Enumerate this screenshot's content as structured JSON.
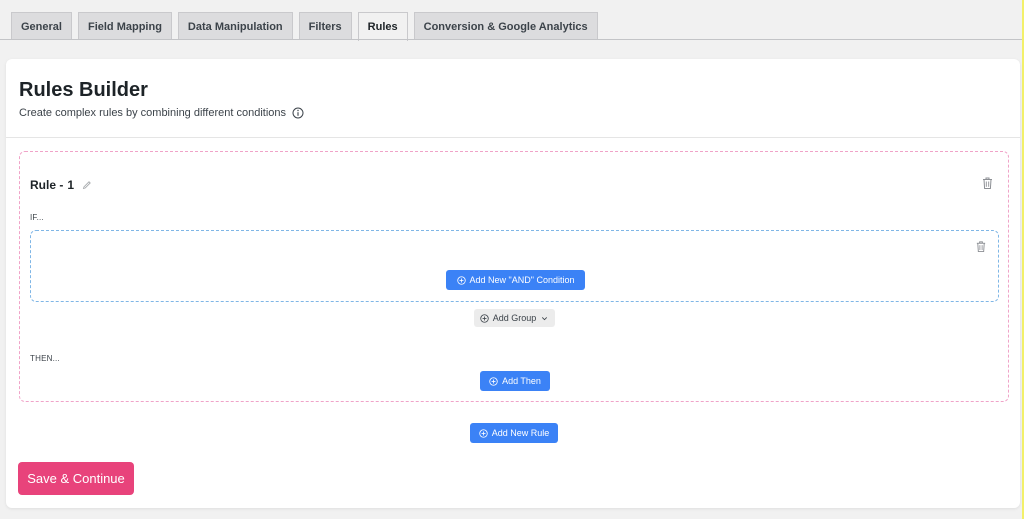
{
  "tabs": [
    {
      "label": "General",
      "active": false
    },
    {
      "label": "Field Mapping",
      "active": false
    },
    {
      "label": "Data Manipulation",
      "active": false
    },
    {
      "label": "Filters",
      "active": false
    },
    {
      "label": "Rules",
      "active": true
    },
    {
      "label": "Conversion & Google Analytics",
      "active": false
    }
  ],
  "builder": {
    "title": "Rules Builder",
    "subtitle": "Create complex rules by combining different conditions"
  },
  "rule": {
    "title_prefix": "Rule -",
    "number": "1",
    "if_label": "IF...",
    "then_label": "THEN...",
    "add_and_condition_label": "Add New \"AND\" Condition",
    "add_group_label": "Add Group",
    "add_then_label": "Add Then"
  },
  "actions": {
    "add_new_rule_label": "Add New Rule",
    "save_label": "Save & Continue"
  },
  "colors": {
    "primary_button": "#3b82f6",
    "save_button": "#e8437b",
    "rule_border": "#f0a3c8",
    "group_border": "#7fb6e6"
  },
  "icons": {
    "info": "info-circle-icon",
    "edit": "pencil-icon",
    "delete": "trash-icon",
    "add": "plus-circle-icon",
    "dropdown": "chevron-down-icon"
  }
}
